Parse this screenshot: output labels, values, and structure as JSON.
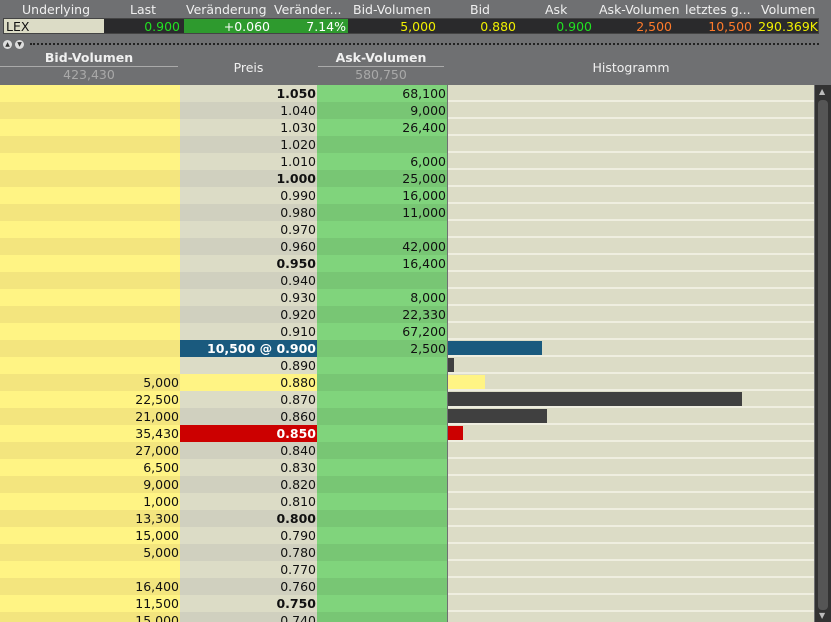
{
  "quote": {
    "headers": [
      "Underlying",
      "Last",
      "Veränderung",
      "Veränder...",
      "Bid-Volumen",
      "Bid",
      "Ask",
      "Ask-Volumen",
      "letztes g...",
      "Volumen"
    ],
    "values": [
      "LEX",
      "0.900",
      "+0.060",
      "7.14%",
      "5,000",
      "0.880",
      "0.900",
      "2,500",
      "10,500",
      "290.369K"
    ]
  },
  "book": {
    "bid_header": "Bid-Volumen",
    "bid_total": "423,430",
    "price_header": "Preis",
    "ask_header": "Ask-Volumen",
    "ask_total": "580,750",
    "hist_header": "Histogramm",
    "rows": [
      {
        "p": "1.050",
        "a": "68,100",
        "b": "",
        "bold": true
      },
      {
        "p": "1.040",
        "a": "9,000",
        "b": ""
      },
      {
        "p": "1.030",
        "a": "26,400",
        "b": ""
      },
      {
        "p": "1.020",
        "a": "",
        "b": ""
      },
      {
        "p": "1.010",
        "a": "6,000",
        "b": ""
      },
      {
        "p": "1.000",
        "a": "25,000",
        "b": "",
        "bold": true
      },
      {
        "p": "0.990",
        "a": "16,000",
        "b": ""
      },
      {
        "p": "0.980",
        "a": "11,000",
        "b": ""
      },
      {
        "p": "0.970",
        "a": "",
        "b": ""
      },
      {
        "p": "0.960",
        "a": "42,000",
        "b": ""
      },
      {
        "p": "0.950",
        "a": "16,400",
        "b": "",
        "bold": true
      },
      {
        "p": "0.940",
        "a": "",
        "b": ""
      },
      {
        "p": "0.930",
        "a": "8,000",
        "b": ""
      },
      {
        "p": "0.920",
        "a": "22,330",
        "b": ""
      },
      {
        "p": "0.910",
        "a": "67,200",
        "b": ""
      },
      {
        "p": "10,500 @ 0.900",
        "a": "2,500",
        "b": "",
        "bold": true,
        "state": "last",
        "hist": 0.257,
        "histColor": "#1a5a7e"
      },
      {
        "p": "0.890",
        "a": "",
        "b": "",
        "hist": 0.016,
        "histColor": "#404040"
      },
      {
        "p": "0.880",
        "a": "",
        "b": "5,000",
        "state": "bid",
        "hist": 0.1,
        "histColor": "#fff484"
      },
      {
        "p": "0.870",
        "a": "",
        "b": "22,500",
        "hist": 0.803,
        "histColor": "#404040"
      },
      {
        "p": "0.860",
        "a": "",
        "b": "21,000",
        "hist": 0.27,
        "histColor": "#404040"
      },
      {
        "p": "0.850",
        "a": "",
        "b": "35,430",
        "bold": true,
        "state": "low",
        "hist": 0.04,
        "histColor": "#cc0000"
      },
      {
        "p": "0.840",
        "a": "",
        "b": "27,000"
      },
      {
        "p": "0.830",
        "a": "",
        "b": "6,500"
      },
      {
        "p": "0.820",
        "a": "",
        "b": "9,000"
      },
      {
        "p": "0.810",
        "a": "",
        "b": "1,000"
      },
      {
        "p": "0.800",
        "a": "",
        "b": "13,300",
        "bold": true
      },
      {
        "p": "0.790",
        "a": "",
        "b": "15,000"
      },
      {
        "p": "0.780",
        "a": "",
        "b": "5,000"
      },
      {
        "p": "0.770",
        "a": "",
        "b": ""
      },
      {
        "p": "0.760",
        "a": "",
        "b": "16,400"
      },
      {
        "p": "0.750",
        "a": "",
        "b": "11,500",
        "bold": true
      },
      {
        "p": "0.740",
        "a": "",
        "b": "15,000"
      }
    ]
  },
  "colors": {
    "bidA": "#fff484",
    "bidB": "#f3e57e",
    "prA": "#dcdcc6",
    "prB": "#d0d0bf",
    "askA": "#80d47c",
    "askB": "#78c674",
    "last": "#1a5a7e",
    "low": "#cc0000"
  }
}
